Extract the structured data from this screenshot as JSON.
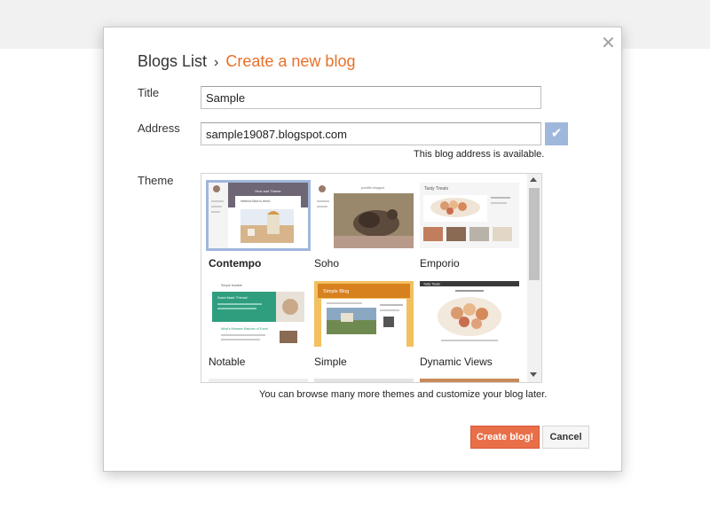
{
  "breadcrumb": {
    "parent": "Blogs List",
    "separator": "›",
    "current": "Create a new blog"
  },
  "form": {
    "title_label": "Title",
    "title_value": "Sample",
    "address_label": "Address",
    "address_value": "sample19087.blogspot.com",
    "address_status": "This blog address is available.",
    "theme_label": "Theme"
  },
  "themes": [
    {
      "name": "Contempo",
      "selected": true
    },
    {
      "name": "Soho",
      "selected": false
    },
    {
      "name": "Emporio",
      "selected": false
    },
    {
      "name": "Notable",
      "selected": false
    },
    {
      "name": "Simple",
      "selected": false
    },
    {
      "name": "Dynamic Views",
      "selected": false
    }
  ],
  "thumb_text": {
    "contempo_header": "Hive and Theme",
    "contempo_post": "Hellenic Blue is trend.",
    "soho_header": "yourtitle.blogspot",
    "emporio_header": "Tasty Treats",
    "notable_header": "Simple Notable",
    "notable_card": "Sweet Made \"Friends\"",
    "notable_post": "What's Between Batches of Everit",
    "simple_header": "Simple Blog",
    "dynamic_header": "Tasty Treats"
  },
  "themes_hint": "You can browse many more themes and customize your blog later.",
  "buttons": {
    "create": "Create blog!",
    "cancel": "Cancel"
  },
  "icons": {
    "close": "close-icon",
    "check": "checkmark-icon"
  },
  "colors": {
    "accent": "#e8702a",
    "primary_button": "#e96f48",
    "selection": "#a0b7dc"
  }
}
